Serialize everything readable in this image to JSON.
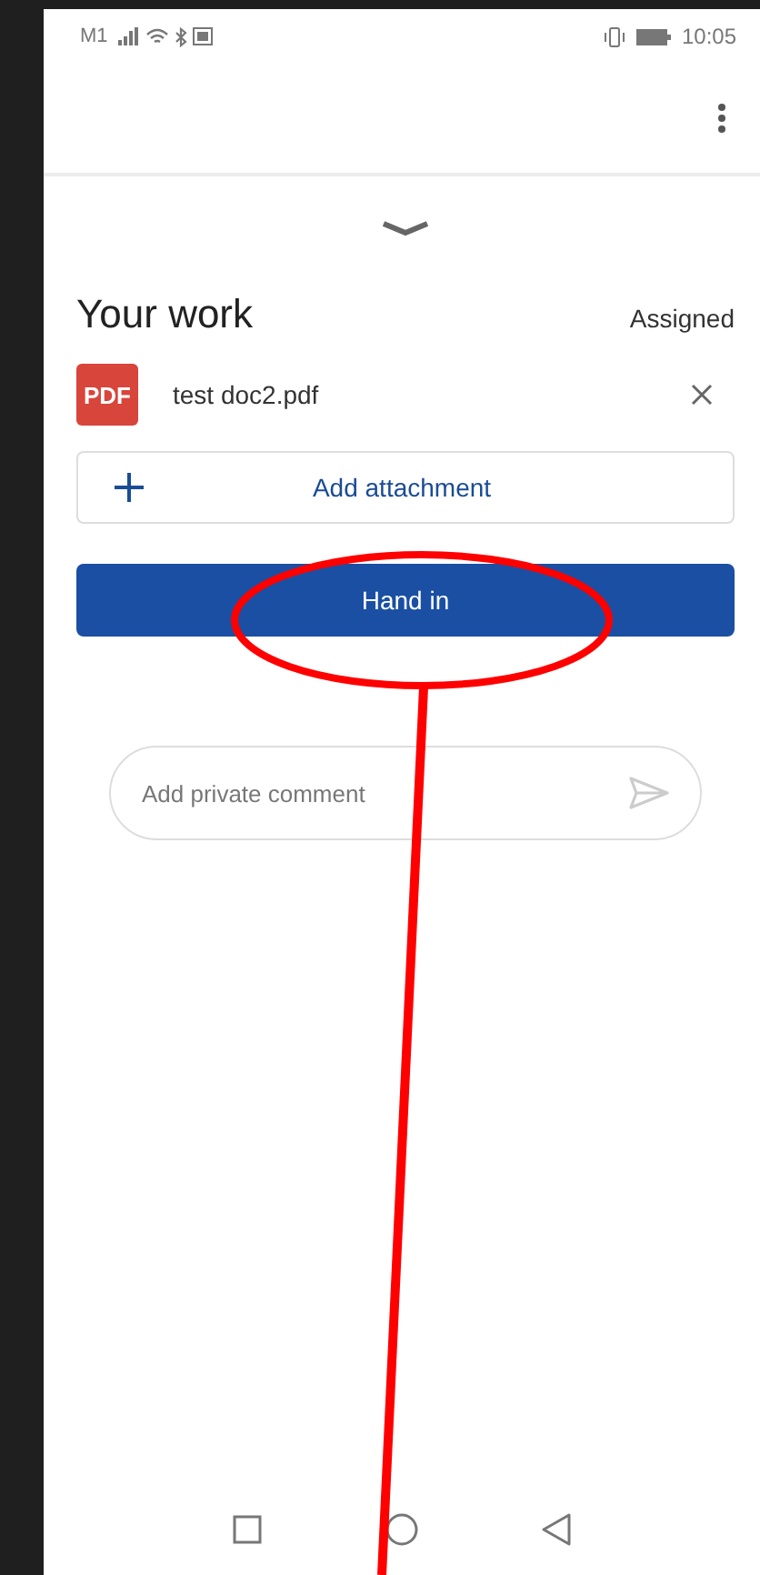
{
  "status_bar": {
    "carrier": "M1",
    "time": "10:05"
  },
  "your_work": {
    "title": "Your work",
    "status": "Assigned",
    "attachments": [
      {
        "kind": "pdf",
        "badge": "PDF",
        "name": "test doc2.pdf"
      }
    ],
    "add_button": "Add attachment",
    "hand_in_button": "Hand in"
  },
  "comment": {
    "placeholder": "Add private comment"
  }
}
